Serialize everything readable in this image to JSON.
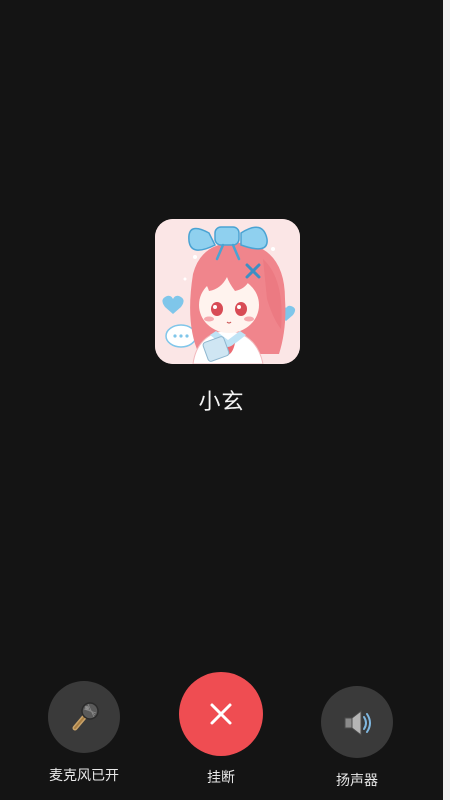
{
  "caller": {
    "name": "小玄",
    "avatar_icon": "anime-girl-avatar"
  },
  "controls": {
    "mic": {
      "label": "麦克风已开",
      "icon": "microphone-icon"
    },
    "hangup": {
      "label": "挂断",
      "icon": "close-icon"
    },
    "speaker": {
      "label": "扬声器",
      "icon": "speaker-icon"
    }
  },
  "colors": {
    "background": "#141414",
    "hangup": "#ef4d52",
    "control_bg": "#3a3a3a",
    "text": "#f4f4f4"
  }
}
